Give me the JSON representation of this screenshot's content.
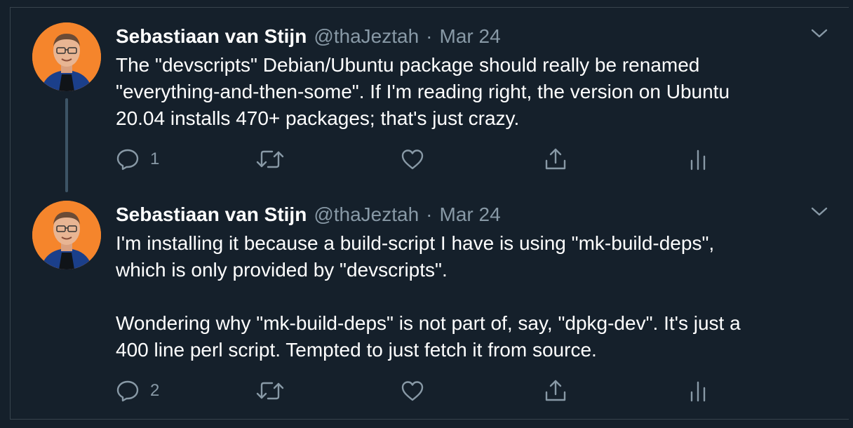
{
  "tweets": [
    {
      "author_name": "Sebastiaan van Stijn",
      "handle": "@thaJeztah",
      "separator": "·",
      "date": "Mar 24",
      "lines": [
        "The \"devscripts\" Debian/Ubuntu package should really be renamed",
        "\"everything-and-then-some\". If I'm reading right, the version on Ubuntu",
        "20.04 installs 470+ packages; that's just crazy."
      ],
      "reply_count": "1"
    },
    {
      "author_name": "Sebastiaan van Stijn",
      "handle": "@thaJeztah",
      "separator": "·",
      "date": "Mar 24",
      "lines": [
        "I'm installing it because a build-script I have is using \"mk-build-deps\",",
        "which is only provided by \"devscripts\".",
        "",
        "Wondering why \"mk-build-deps\" is not part of, say, \"dpkg-dev\". It's just a",
        "400 line perl script. Tempted to just fetch it from source."
      ],
      "reply_count": "2"
    }
  ],
  "icons": {
    "reply": "reply-icon",
    "retweet": "retweet-icon",
    "like": "like-icon",
    "share": "share-icon",
    "analytics": "analytics-icon",
    "more": "chevron-down-icon"
  },
  "colors": {
    "background": "#15202b",
    "secondary_text": "#8899a6",
    "border": "#38444d",
    "thread_line": "#3d5466",
    "avatar_bg": "#f5852c"
  }
}
